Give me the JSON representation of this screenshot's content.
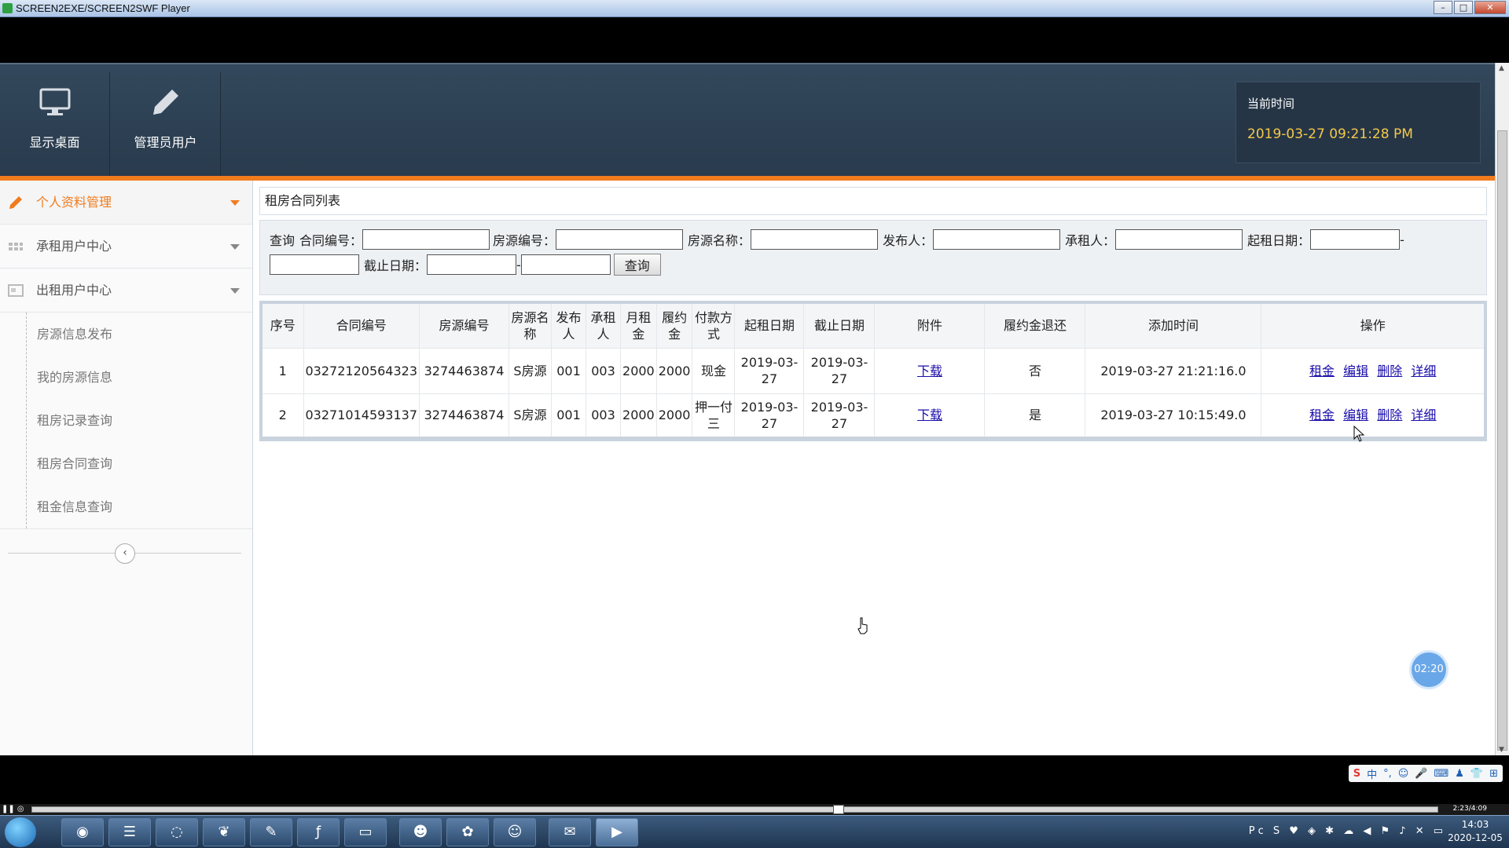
{
  "window": {
    "title": "SCREEN2EXE/SCREEN2SWF Player"
  },
  "topnav": {
    "items": [
      {
        "label": "显示桌面",
        "icon": "monitor-icon"
      },
      {
        "label": "管理员用户",
        "icon": "pencil-icon"
      }
    ],
    "time_label": "当前时间",
    "time_value": "2019-03-27 09:21:28 PM"
  },
  "sidebar": {
    "groups": [
      {
        "label": "个人资料管理",
        "icon": "pencil-icon",
        "active": true
      },
      {
        "label": "承租用户中心",
        "icon": "grid-icon",
        "active": false
      },
      {
        "label": "出租用户中心",
        "icon": "window-icon",
        "active": false
      }
    ],
    "subitems": [
      "房源信息发布",
      "我的房源信息",
      "租房记录查询",
      "租房合同查询",
      "租金信息查询"
    ],
    "collapse_symbol": "‹"
  },
  "main": {
    "panel_title": "租房合同列表",
    "search": {
      "prefix": "查询",
      "contract_no": "合同编号：",
      "house_no": "房源编号：",
      "house_name": "房源名称：",
      "publisher": "发布人：",
      "tenant": "承租人：",
      "start_date": "起租日期：",
      "dash": "-",
      "end_date": "截止日期：",
      "dash2": "-",
      "button": "查询"
    },
    "table": {
      "headers": [
        "序号",
        "合同编号",
        "房源编号",
        "房源名称",
        "发布人",
        "承租人",
        "月租金",
        "履约金",
        "付款方式",
        "起租日期",
        "截止日期",
        "附件",
        "履约金退还",
        "添加时间",
        "操作"
      ],
      "rows": [
        {
          "no": "1",
          "contract": "03272120564323",
          "house": "3274463874",
          "name": "S房源",
          "publisher": "001",
          "tenant": "003",
          "rent": "2000",
          "deposit": "2000",
          "pay": "现金",
          "start": "2019-03-27",
          "end": "2019-03-27",
          "attachment": "下载",
          "refund": "否",
          "added": "2019-03-27 21:21:16.0",
          "ops": [
            "租金",
            "编辑",
            "删除",
            "详细"
          ]
        },
        {
          "no": "2",
          "contract": "03271014593137",
          "house": "3274463874",
          "name": "S房源",
          "publisher": "001",
          "tenant": "003",
          "rent": "2000",
          "deposit": "2000",
          "pay": "押一付三",
          "start": "2019-03-27",
          "end": "2019-03-27",
          "attachment": "下载",
          "refund": "是",
          "added": "2019-03-27 10:15:49.0",
          "ops": [
            "租金",
            "编辑",
            "删除",
            "详细"
          ]
        }
      ]
    },
    "timer": "02:20"
  },
  "player": {
    "time": "2:23/4:09"
  },
  "ime": {
    "items": [
      "中",
      "°,",
      "☺",
      "🎤",
      "⌨",
      "♟",
      "👕",
      "⊞"
    ]
  },
  "taskbar": {
    "apps": [
      "chrome-icon",
      "terminal-icon",
      "browser-icon",
      "leaf-icon",
      "notepad-icon",
      "flash-icon",
      "folder-icon",
      "qq-icon",
      "share-icon",
      "avatar-icon",
      "wechat-icon",
      "recorder-icon"
    ],
    "clock_time": "14:03",
    "clock_date": "2020-12-05"
  },
  "colors": {
    "accent": "#f07c1e",
    "nav_bg": "#2d4155",
    "link": "#1a0dab",
    "time": "#f5c84b"
  }
}
